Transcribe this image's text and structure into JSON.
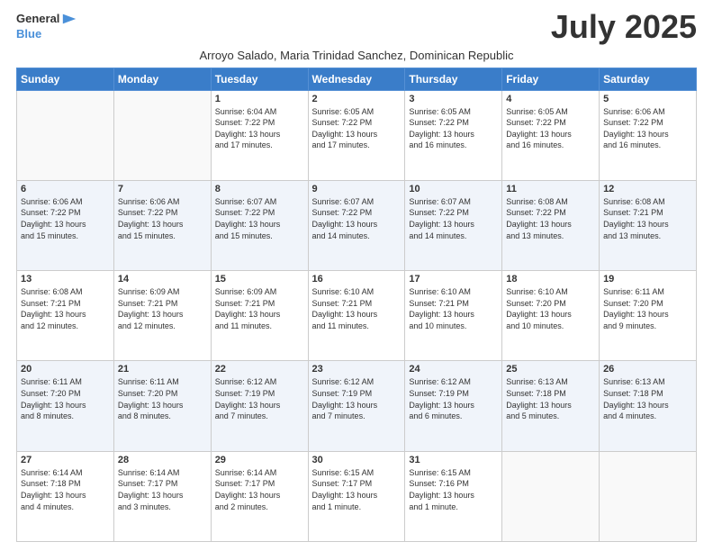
{
  "logo": {
    "line1": "General",
    "line2": "Blue",
    "icon": "▶"
  },
  "title": "July 2025",
  "subtitle": "Arroyo Salado, Maria Trinidad Sanchez, Dominican Republic",
  "days_of_week": [
    "Sunday",
    "Monday",
    "Tuesday",
    "Wednesday",
    "Thursday",
    "Friday",
    "Saturday"
  ],
  "weeks": [
    [
      {
        "day": "",
        "info": ""
      },
      {
        "day": "",
        "info": ""
      },
      {
        "day": "1",
        "info": "Sunrise: 6:04 AM\nSunset: 7:22 PM\nDaylight: 13 hours\nand 17 minutes."
      },
      {
        "day": "2",
        "info": "Sunrise: 6:05 AM\nSunset: 7:22 PM\nDaylight: 13 hours\nand 17 minutes."
      },
      {
        "day": "3",
        "info": "Sunrise: 6:05 AM\nSunset: 7:22 PM\nDaylight: 13 hours\nand 16 minutes."
      },
      {
        "day": "4",
        "info": "Sunrise: 6:05 AM\nSunset: 7:22 PM\nDaylight: 13 hours\nand 16 minutes."
      },
      {
        "day": "5",
        "info": "Sunrise: 6:06 AM\nSunset: 7:22 PM\nDaylight: 13 hours\nand 16 minutes."
      }
    ],
    [
      {
        "day": "6",
        "info": "Sunrise: 6:06 AM\nSunset: 7:22 PM\nDaylight: 13 hours\nand 15 minutes."
      },
      {
        "day": "7",
        "info": "Sunrise: 6:06 AM\nSunset: 7:22 PM\nDaylight: 13 hours\nand 15 minutes."
      },
      {
        "day": "8",
        "info": "Sunrise: 6:07 AM\nSunset: 7:22 PM\nDaylight: 13 hours\nand 15 minutes."
      },
      {
        "day": "9",
        "info": "Sunrise: 6:07 AM\nSunset: 7:22 PM\nDaylight: 13 hours\nand 14 minutes."
      },
      {
        "day": "10",
        "info": "Sunrise: 6:07 AM\nSunset: 7:22 PM\nDaylight: 13 hours\nand 14 minutes."
      },
      {
        "day": "11",
        "info": "Sunrise: 6:08 AM\nSunset: 7:22 PM\nDaylight: 13 hours\nand 13 minutes."
      },
      {
        "day": "12",
        "info": "Sunrise: 6:08 AM\nSunset: 7:21 PM\nDaylight: 13 hours\nand 13 minutes."
      }
    ],
    [
      {
        "day": "13",
        "info": "Sunrise: 6:08 AM\nSunset: 7:21 PM\nDaylight: 13 hours\nand 12 minutes."
      },
      {
        "day": "14",
        "info": "Sunrise: 6:09 AM\nSunset: 7:21 PM\nDaylight: 13 hours\nand 12 minutes."
      },
      {
        "day": "15",
        "info": "Sunrise: 6:09 AM\nSunset: 7:21 PM\nDaylight: 13 hours\nand 11 minutes."
      },
      {
        "day": "16",
        "info": "Sunrise: 6:10 AM\nSunset: 7:21 PM\nDaylight: 13 hours\nand 11 minutes."
      },
      {
        "day": "17",
        "info": "Sunrise: 6:10 AM\nSunset: 7:21 PM\nDaylight: 13 hours\nand 10 minutes."
      },
      {
        "day": "18",
        "info": "Sunrise: 6:10 AM\nSunset: 7:20 PM\nDaylight: 13 hours\nand 10 minutes."
      },
      {
        "day": "19",
        "info": "Sunrise: 6:11 AM\nSunset: 7:20 PM\nDaylight: 13 hours\nand 9 minutes."
      }
    ],
    [
      {
        "day": "20",
        "info": "Sunrise: 6:11 AM\nSunset: 7:20 PM\nDaylight: 13 hours\nand 8 minutes."
      },
      {
        "day": "21",
        "info": "Sunrise: 6:11 AM\nSunset: 7:20 PM\nDaylight: 13 hours\nand 8 minutes."
      },
      {
        "day": "22",
        "info": "Sunrise: 6:12 AM\nSunset: 7:19 PM\nDaylight: 13 hours\nand 7 minutes."
      },
      {
        "day": "23",
        "info": "Sunrise: 6:12 AM\nSunset: 7:19 PM\nDaylight: 13 hours\nand 7 minutes."
      },
      {
        "day": "24",
        "info": "Sunrise: 6:12 AM\nSunset: 7:19 PM\nDaylight: 13 hours\nand 6 minutes."
      },
      {
        "day": "25",
        "info": "Sunrise: 6:13 AM\nSunset: 7:18 PM\nDaylight: 13 hours\nand 5 minutes."
      },
      {
        "day": "26",
        "info": "Sunrise: 6:13 AM\nSunset: 7:18 PM\nDaylight: 13 hours\nand 4 minutes."
      }
    ],
    [
      {
        "day": "27",
        "info": "Sunrise: 6:14 AM\nSunset: 7:18 PM\nDaylight: 13 hours\nand 4 minutes."
      },
      {
        "day": "28",
        "info": "Sunrise: 6:14 AM\nSunset: 7:17 PM\nDaylight: 13 hours\nand 3 minutes."
      },
      {
        "day": "29",
        "info": "Sunrise: 6:14 AM\nSunset: 7:17 PM\nDaylight: 13 hours\nand 2 minutes."
      },
      {
        "day": "30",
        "info": "Sunrise: 6:15 AM\nSunset: 7:17 PM\nDaylight: 13 hours\nand 1 minute."
      },
      {
        "day": "31",
        "info": "Sunrise: 6:15 AM\nSunset: 7:16 PM\nDaylight: 13 hours\nand 1 minute."
      },
      {
        "day": "",
        "info": ""
      },
      {
        "day": "",
        "info": ""
      }
    ]
  ]
}
